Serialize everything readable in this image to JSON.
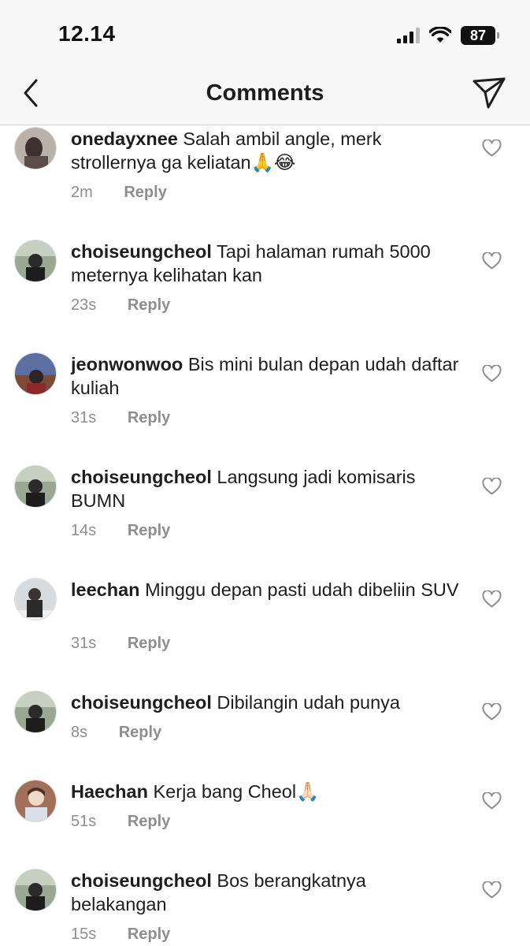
{
  "status_bar": {
    "time": "12.14",
    "battery": "87"
  },
  "header": {
    "title": "Comments"
  },
  "comments": [
    {
      "username": "onedayxnee",
      "text": "Salah ambil angle, merk strollernya ga keliatan🙏😂",
      "time": "2m",
      "reply": "Reply",
      "avatar_color": "#8a7f78"
    },
    {
      "username": "choiseungcheol",
      "text": "Tapi halaman rumah 5000 meternya kelihatan kan",
      "time": "23s",
      "reply": "Reply",
      "avatar_color": "#5d6b58"
    },
    {
      "username": "jeonwonwoo",
      "text": "Bis mini bulan depan udah daftar kuliah",
      "time": "31s",
      "reply": "Reply",
      "avatar_color": "#5b6fa3"
    },
    {
      "username": "choiseungcheol",
      "text": "Langsung jadi komisaris BUMN",
      "time": "14s",
      "reply": "Reply",
      "avatar_color": "#5d6b58"
    },
    {
      "username": "leechan",
      "text": "Minggu depan pasti udah dibeliin SUV",
      "time": "31s",
      "reply": "Reply",
      "avatar_color": "#c9ccd0"
    },
    {
      "username": "choiseungcheol",
      "text": "Dibilangin udah punya",
      "time": "8s",
      "reply": "Reply",
      "avatar_color": "#5d6b58"
    },
    {
      "username": "Haechan",
      "text": "Kerja bang Cheol🙏🏻",
      "time": "51s",
      "reply": "Reply",
      "avatar_color": "#a0705a"
    },
    {
      "username": "choiseungcheol",
      "text": "Bos berangkatnya belakangan",
      "time": "15s",
      "reply": "Reply",
      "avatar_color": "#5d6b58"
    }
  ]
}
